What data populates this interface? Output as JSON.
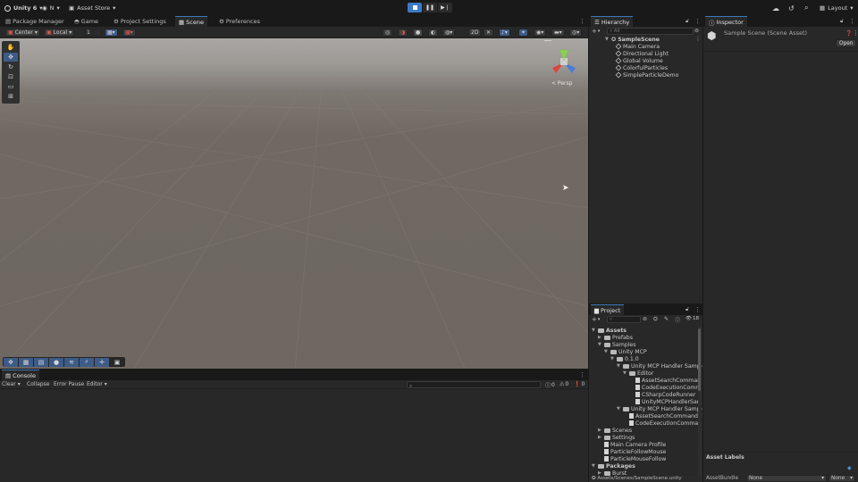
{
  "topbar": {
    "account_label": "Unity 6",
    "user_label": "N",
    "asset_store_label": "Asset Store",
    "layout_label": "Layout"
  },
  "main_tabs": [
    {
      "label": "Package Manager",
      "icon": "package-icon"
    },
    {
      "label": "Game",
      "icon": "gamepad-icon"
    },
    {
      "label": "Project Settings",
      "icon": "gear-icon"
    },
    {
      "label": "Scene",
      "icon": "scene-icon"
    },
    {
      "label": "Preferences",
      "icon": "gear-icon"
    }
  ],
  "scene_toolbar": {
    "pivot_label": "Center",
    "space_label": "Local",
    "grid_value": "1",
    "mode_2d_label": "2D",
    "persp_label": "< Persp"
  },
  "console": {
    "tab_label": "Console",
    "clear_label": "Clear",
    "collapse_label": "Collapse",
    "error_pause_label": "Error Pause",
    "editor_label": "Editor",
    "log_count": "0",
    "warn_count": "0",
    "error_count": "0"
  },
  "hierarchy": {
    "tab_label": "Hierarchy",
    "search_placeholder": "All",
    "scene_name": "SampleScene",
    "items": [
      "Main Camera",
      "Directional Light",
      "Global Volume",
      "ColorfulParticles",
      "SimpleParticleDemo"
    ]
  },
  "inspector": {
    "tab_label": "Inspector",
    "title": "Sample Scene (Scene Asset)",
    "open_label": "Open",
    "asset_labels": "Asset Labels",
    "assetbundle_label": "AssetBundle",
    "assetbundle_value": "None",
    "variant_value": "None"
  },
  "project": {
    "tab_label": "Project",
    "hidden_count": "18",
    "status_path": "Assets/Scenes/SampleScene.unity",
    "tree": [
      {
        "label": "Assets",
        "indent": 0,
        "kind": "folder-open",
        "bold": true
      },
      {
        "label": "Prefabs",
        "indent": 1,
        "kind": "folder"
      },
      {
        "label": "Samples",
        "indent": 1,
        "kind": "folder-open"
      },
      {
        "label": "Unity MCP",
        "indent": 2,
        "kind": "folder-open"
      },
      {
        "label": "0.1.0",
        "indent": 3,
        "kind": "folder-open"
      },
      {
        "label": "Unity MCP Handler Sample",
        "indent": 4,
        "kind": "folder-open"
      },
      {
        "label": "Editor",
        "indent": 5,
        "kind": "folder-open"
      },
      {
        "label": "AssetSearchComman",
        "indent": 6,
        "kind": "file"
      },
      {
        "label": "CodeExecutionComm",
        "indent": 6,
        "kind": "file"
      },
      {
        "label": "CSharpCodeRunner",
        "indent": 6,
        "kind": "file"
      },
      {
        "label": "UnityMCPHandlerSan",
        "indent": 6,
        "kind": "file"
      },
      {
        "label": "Unity MCP Handler Sample",
        "indent": 4,
        "kind": "folder-open"
      },
      {
        "label": "AssetSearchCommandH",
        "indent": 5,
        "kind": "file"
      },
      {
        "label": "CodeExecutionComman",
        "indent": 5,
        "kind": "file"
      },
      {
        "label": "Scenes",
        "indent": 1,
        "kind": "folder"
      },
      {
        "label": "Settings",
        "indent": 1,
        "kind": "folder"
      },
      {
        "label": "Main Camera Profile",
        "indent": 1,
        "kind": "file"
      },
      {
        "label": "ParticleFollowMouse",
        "indent": 1,
        "kind": "file"
      },
      {
        "label": "ParticleMouseFollow",
        "indent": 1,
        "kind": "file"
      },
      {
        "label": "Packages",
        "indent": 0,
        "kind": "folder-open",
        "bold": true
      },
      {
        "label": "Burst",
        "indent": 1,
        "kind": "folder"
      }
    ]
  },
  "colors": {
    "accent": "#3d79c9",
    "panel_bg": "#282828",
    "window_bg": "#191919",
    "scene_sky": "#a8a6a3",
    "scene_ground": "#6d6661"
  }
}
